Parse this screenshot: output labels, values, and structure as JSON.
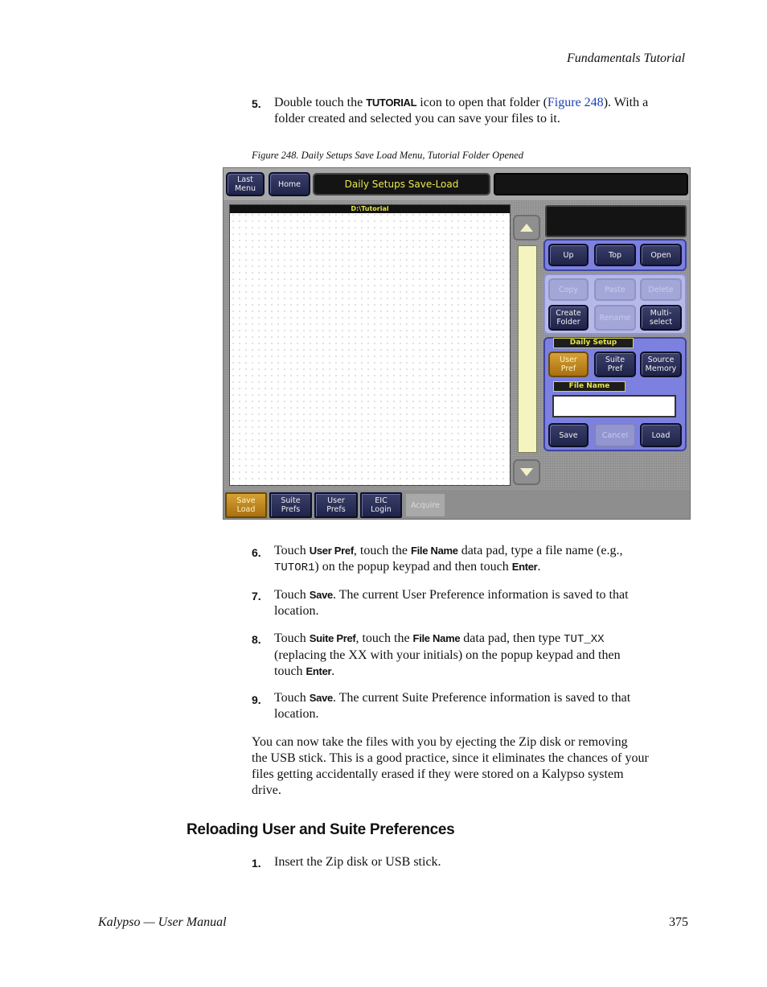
{
  "header": {
    "section": "Fundamentals Tutorial"
  },
  "step5": {
    "num": "5.",
    "t1": "Double touch the ",
    "b1": "TUTORIAL",
    "t2": " icon to open that folder (",
    "link": "Figure 248",
    "t3": "). With a",
    "line2": "folder created and selected you can save your files to it."
  },
  "figure": {
    "caption": "Figure 248.  Daily Setups Save Load Menu, Tutorial Folder Opened",
    "ui": {
      "last_menu": "Last\nMenu",
      "home": "Home",
      "title": "Daily Setups Save-Load",
      "path": "D:\\Tutorial",
      "buttons": {
        "up": "Up",
        "top": "Top",
        "open": "Open",
        "copy": "Copy",
        "paste": "Paste",
        "delete": "Delete",
        "create_folder": "Create\nFolder",
        "rename": "Rename",
        "multi_select": "Multi-\nselect",
        "user_pref": "User\nPref",
        "suite_pref": "Suite\nPref",
        "source_memory": "Source\nMemory",
        "save": "Save",
        "cancel": "Cancel",
        "load": "Load"
      },
      "daily_setup_label": "Daily Setup",
      "file_name_label": "File Name",
      "tabs": {
        "save_load": "Save\nLoad",
        "suite_prefs": "Suite\nPrefs",
        "user_prefs": "User\nPrefs",
        "eic_login": "EIC\nLogin",
        "acquire": "Acquire"
      },
      "colors": {
        "panel_blue": "#7c80de",
        "gold": "#c8901f",
        "scroll_yellow": "#f5f3bf"
      }
    }
  },
  "step6": {
    "num": "6.",
    "t1": "Touch ",
    "b1": "User Pref",
    "t2": ", touch the ",
    "b2": "File Name",
    "t3": " data pad, type a file name (e.g.,",
    "mono1": "TUTOR1",
    "t4": ") on the popup keypad and then touch ",
    "b3": "Enter",
    "t5": "."
  },
  "step7": {
    "num": "7.",
    "t1": "Touch ",
    "b1": "Save",
    "t2": ". The current User Preference information is saved to that",
    "line2": "location."
  },
  "step8": {
    "num": "8.",
    "t1": "Touch ",
    "b1": "Suite Pref",
    "t2": ", touch the ",
    "b2": "File Name",
    "t3": " data pad, then type ",
    "mono1": "TUT_XX",
    "line2": "(replacing the XX with your initials) on the popup keypad and then",
    "t4": "touch ",
    "b3": "Enter",
    "t5": "."
  },
  "step9": {
    "num": "9.",
    "t1": "Touch ",
    "b1": "Save",
    "t2": ". The current Suite Preference information is saved to that",
    "line2": "location."
  },
  "body_para": {
    "l1": "You can now take the files with you by ejecting the Zip disk or removing",
    "l2": "the USB stick. This is a good practice, since it eliminates the chances of your",
    "l3": "files getting accidentally erased if they were stored on a Kalypso system",
    "l4": "drive."
  },
  "section_heading": "Reloading User and Suite Preferences",
  "step1": {
    "num": "1.",
    "text": "Insert the Zip disk or USB stick."
  },
  "footer": {
    "manual": "Kalypso — User Manual",
    "page": "375"
  }
}
